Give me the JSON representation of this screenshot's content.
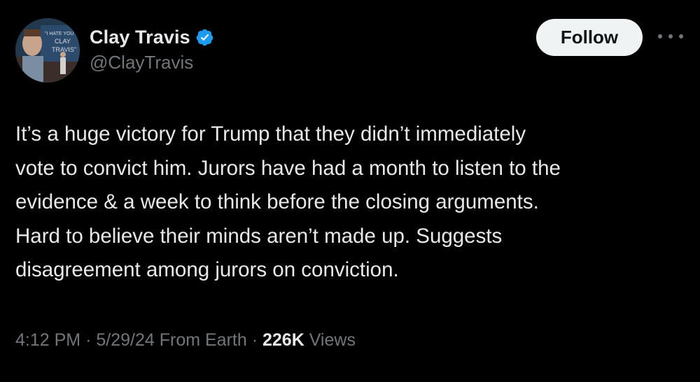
{
  "author": {
    "display_name": "Clay Travis",
    "handle": "@ClayTravis",
    "verified_icon": "verified-badge-icon",
    "verified_color": "#1d9bf0",
    "avatar_sign_lines": [
      "\"I HATE YOU",
      "CLAY",
      "TRAVIS\""
    ]
  },
  "actions": {
    "follow_label": "Follow",
    "more_icon": "more-horizontal-icon"
  },
  "tweet": {
    "text_lines": [
      "It’s a huge victory for Trump that they didn’t immediately",
      "vote to convict him. Jurors have had a month to listen to the",
      "evidence & a week to think before the closing arguments.",
      "Hard to believe their minds aren’t made up. Suggests",
      "disagreement among jurors on conviction."
    ]
  },
  "meta": {
    "time": "4:12 PM",
    "separator": "·",
    "date": "5/29/24",
    "location": "From Earth",
    "views_count": "226K",
    "views_label": "Views"
  },
  "colors": {
    "background": "#000000",
    "primary_text": "#e7e9ea",
    "secondary_text": "#71767b",
    "follow_bg": "#eff3f4"
  }
}
